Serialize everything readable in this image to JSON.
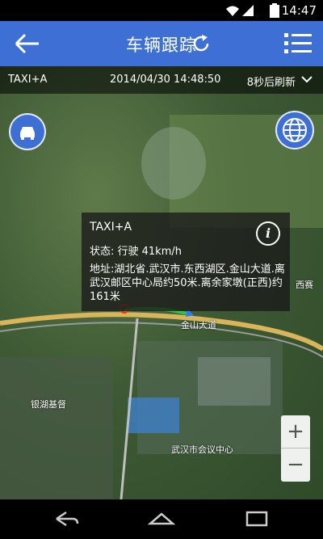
{
  "status_bar": {
    "time": "14:47",
    "icons": [
      "wifi-icon",
      "cell-signal-icon",
      "battery-icon"
    ]
  },
  "app_bar": {
    "title": "车辆跟踪",
    "icons": {
      "back": "back-arrow-icon",
      "refresh": "refresh-icon",
      "menu": "list-menu-icon"
    },
    "color": "#3d6fd4"
  },
  "info_bar": {
    "vehicle": "TAXI+A",
    "timestamp": "2014/04/30 14:48:50",
    "refresh_text": "8秒后刷新"
  },
  "popup": {
    "title": "TAXI+A",
    "status": "状态: 行驶 41km/h",
    "address": "地址:湖北省.武汉市.东西湖区.金山大道.离武汉邮区中心局约50米.离余家墩(正西)约161米"
  },
  "map_labels": [
    "金山大道",
    "银湖基督",
    "武汉市会议中心",
    "西赛"
  ],
  "zoom": {
    "in": "+",
    "out": "−"
  },
  "colors": {
    "track": "#31c248",
    "road": "#d8b45a"
  }
}
